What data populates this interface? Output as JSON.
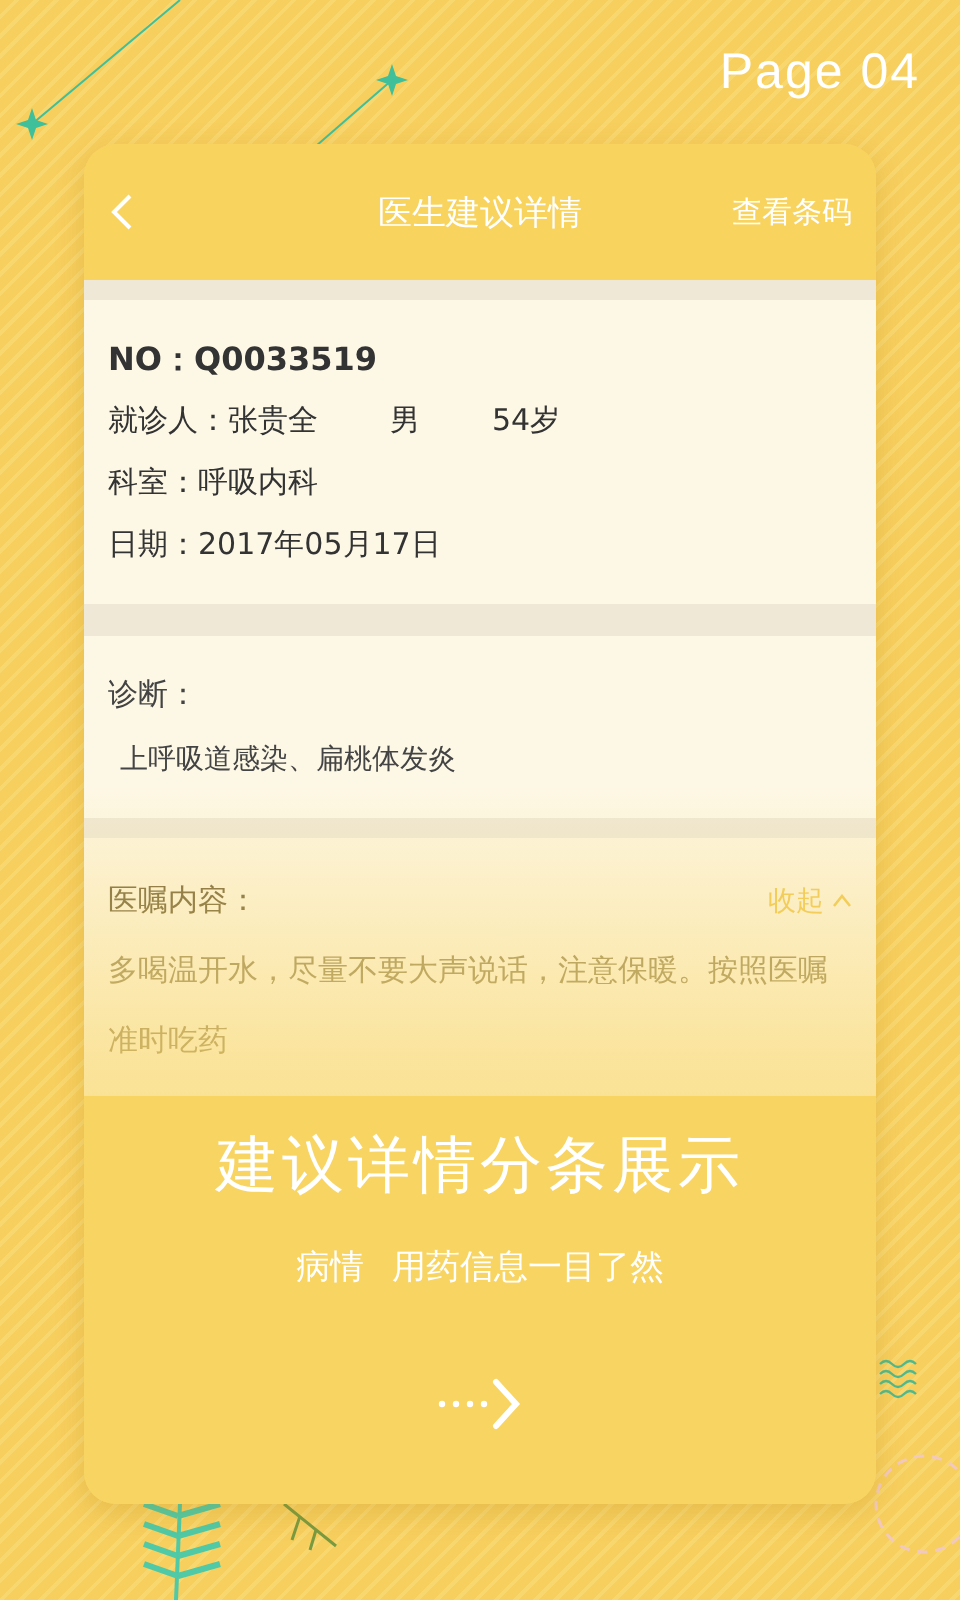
{
  "page_label": "Page 04",
  "header": {
    "title": "医生建议详情",
    "action": "查看条码"
  },
  "info": {
    "number": "NO：Q0033519",
    "patient": {
      "label": "就诊人：张贵全",
      "sex": "男",
      "age": "54岁"
    },
    "department": "科室：呼吸内科",
    "date": "日期：2017年05月17日"
  },
  "diagnosis": {
    "label": "诊断：",
    "text": "上呼吸道感染、扁桃体发炎"
  },
  "advice": {
    "label": "医嘱内容：",
    "toggle": "收起",
    "text": "多喝温开水，尽量不要大声说话，注意保暖。按照医嘱准时吃药"
  },
  "promo": {
    "title": "建议详情分条展示",
    "subtitle": [
      "病情",
      "用药信息一目了然"
    ]
  }
}
